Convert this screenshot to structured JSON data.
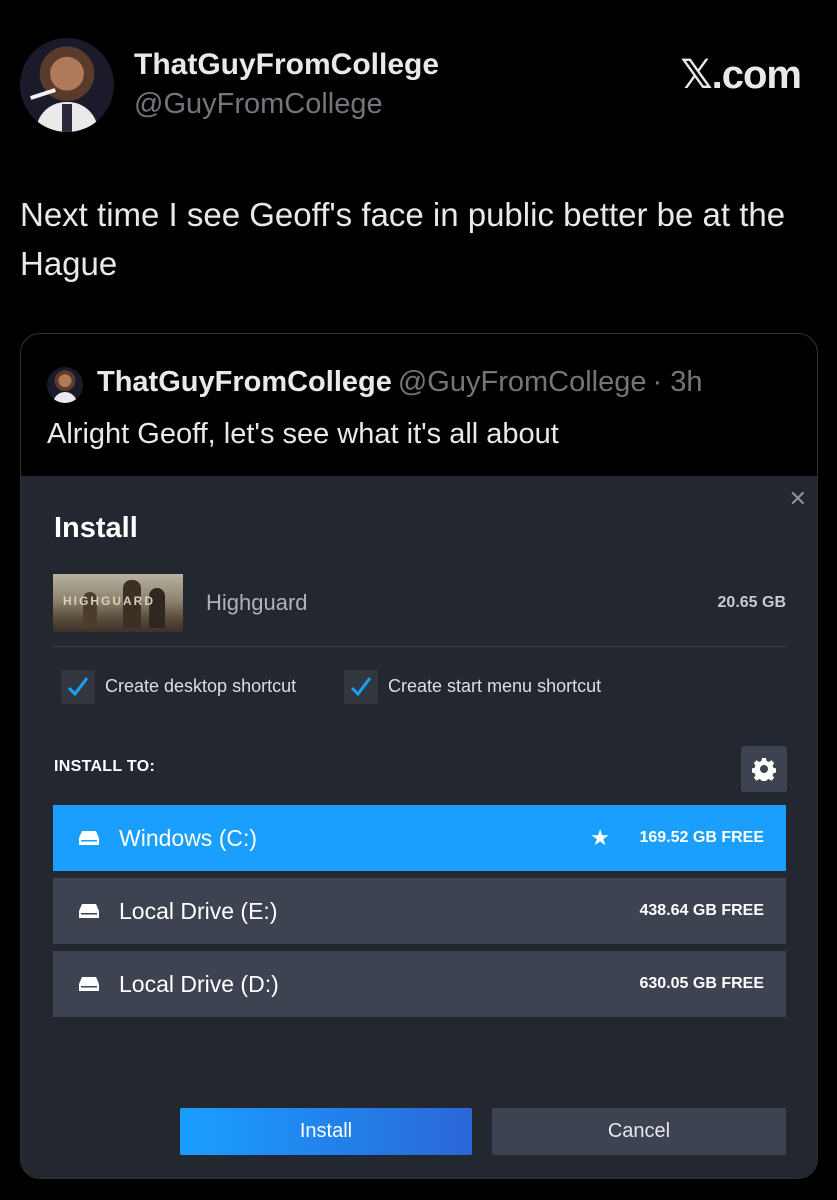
{
  "tweet": {
    "author_name": "ThatGuyFromCollege",
    "author_handle": "@GuyFromCollege",
    "brand": "𝕏.com",
    "text": "Next time I see Geoff's face in public better be at the Hague"
  },
  "quote": {
    "author_name": "ThatGuyFromCollege",
    "author_handle": "@GuyFromCollege",
    "time": "· 3h",
    "text": "Alright Geoff, let's see what it's all about"
  },
  "install_dialog": {
    "close_glyph": "✕",
    "title": "Install",
    "game_image_text": "HIGHGUARD",
    "game_name": "Highguard",
    "game_size": "20.65 GB",
    "checkboxes": [
      {
        "label": "Create desktop shortcut",
        "checked": true
      },
      {
        "label": "Create start menu shortcut",
        "checked": true
      }
    ],
    "install_to_label": "INSTALL TO:",
    "drives": [
      {
        "name": "Windows (C:)",
        "free": "169.52 GB FREE",
        "selected": true,
        "default_star": "★"
      },
      {
        "name": "Local Drive (E:)",
        "free": "438.64 GB FREE",
        "selected": false
      },
      {
        "name": "Local Drive (D:)",
        "free": "630.05 GB FREE",
        "selected": false
      }
    ],
    "install_button": "Install",
    "cancel_button": "Cancel"
  },
  "colors": {
    "accent": "#1a9fff",
    "dialog_bg": "#23272f",
    "row_bg": "#3d4350"
  }
}
